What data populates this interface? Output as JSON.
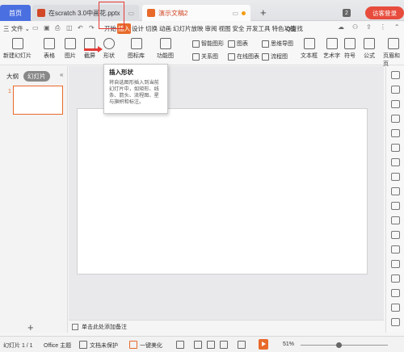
{
  "tabs": {
    "home": "首页",
    "doc1": "在scratch 3.0中画花.pptx",
    "doc2": "演示文稿2",
    "count": "2",
    "login": "访客登录"
  },
  "menu": {
    "file": "三 文件",
    "items": [
      "开始",
      "插入",
      "设计",
      "切换",
      "动画",
      "幻灯片放映",
      "审阅",
      "视图",
      "安全",
      "开发工具",
      "特色功能"
    ],
    "active": "插入",
    "search": "Q查找"
  },
  "ribbon": {
    "new_slide": "新建幻灯片",
    "table": "表格",
    "picture": "图片",
    "screenshot": "截屏",
    "shape": "形状",
    "gallery": "图标库",
    "function_chart": "功能图",
    "smart_shape": "智能图形",
    "chart": "图表",
    "relation": "关系图",
    "online_chart": "在线图表",
    "mindmap": "思维导图",
    "flowchart": "流程图",
    "textbox": "文本框",
    "art_text": "艺术字",
    "symbol": "符号",
    "formula": "公式",
    "header_footer": "页眉和页"
  },
  "tooltip": {
    "title": "插入形状",
    "body": "将自选图形插入到当前幻灯片中，如矩形、线条、箭头、流程图、星与旗帜和标注。"
  },
  "left_panel": {
    "outline": "大纲",
    "slides": "幻灯片",
    "slide_number": "1"
  },
  "notes": {
    "placeholder": "单击此处添加备注"
  },
  "status": {
    "slide_info": "幻灯片 1 / 1",
    "theme": "Office 主题",
    "protect": "文档未保护",
    "beautify": "一键美化",
    "zoom": "51%"
  },
  "colors": {
    "accent": "#e86a2a",
    "highlight": "#e53935",
    "home_tab": "#4a6fe0"
  }
}
